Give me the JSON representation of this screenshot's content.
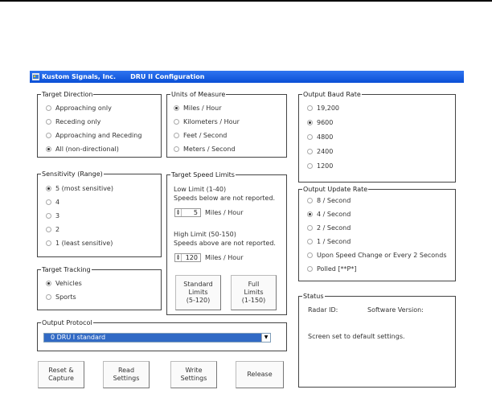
{
  "window": {
    "company": "Kustom Signals, Inc.",
    "title": "DRU II Configuration",
    "icon": "app-icon"
  },
  "target_direction": {
    "legend": "Target Direction",
    "options": [
      "Approaching only",
      "Receding only",
      "Approaching and Receding",
      "All (non-directional)"
    ],
    "selected": 3
  },
  "units": {
    "legend": "Units of Measure",
    "options": [
      "Miles / Hour",
      "Kilometers / Hour",
      "Feet / Second",
      "Meters / Second"
    ],
    "selected": 0
  },
  "baud": {
    "legend": "Output Baud Rate",
    "options": [
      "19,200",
      "9600",
      "4800",
      "2400",
      "1200"
    ],
    "selected": 1
  },
  "sensitivity": {
    "legend": "Sensitivity (Range)",
    "options": [
      "5  (most sensitive)",
      "4",
      "3",
      "2",
      "1  (least sensitive)"
    ],
    "selected": 0
  },
  "speed_limits": {
    "legend": "Target Speed Limits",
    "low_label": "Low Limit (1-40)",
    "low_desc": "Speeds below are not reported.",
    "low_value": "5",
    "low_unit": "Miles / Hour",
    "high_label": "High Limit (50-150)",
    "high_desc": "Speeds above are not reported.",
    "high_value": "120",
    "high_unit": "Miles / Hour",
    "standard_button": [
      "Standard",
      "Limits",
      "(5-120)"
    ],
    "full_button": [
      "Full",
      "Limits",
      "(1-150)"
    ]
  },
  "update_rate": {
    "legend": "Output Update Rate",
    "options": [
      "8 / Second",
      "4 / Second",
      "2 / Second",
      "1 / Second",
      "Upon Speed Change or Every 2 Seconds",
      "Polled [**P*]"
    ],
    "selected": 1
  },
  "tracking": {
    "legend": "Target Tracking",
    "options": [
      "Vehicles",
      "Sports"
    ],
    "selected": 0
  },
  "status": {
    "legend": "Status",
    "radar_id_label": "Radar ID:",
    "software_label": "Software Version:",
    "message": "Screen set to default settings."
  },
  "protocol": {
    "legend": "Output Protocol",
    "selected_value": "0  DRU I standard"
  },
  "buttons": {
    "reset": [
      "Reset &",
      "Capture"
    ],
    "read": [
      "Read",
      "Settings"
    ],
    "write": [
      "Write",
      "Settings"
    ],
    "release": "Release"
  },
  "colors": {
    "titlebar": "#0a4fd6",
    "selection": "#316ac5"
  }
}
